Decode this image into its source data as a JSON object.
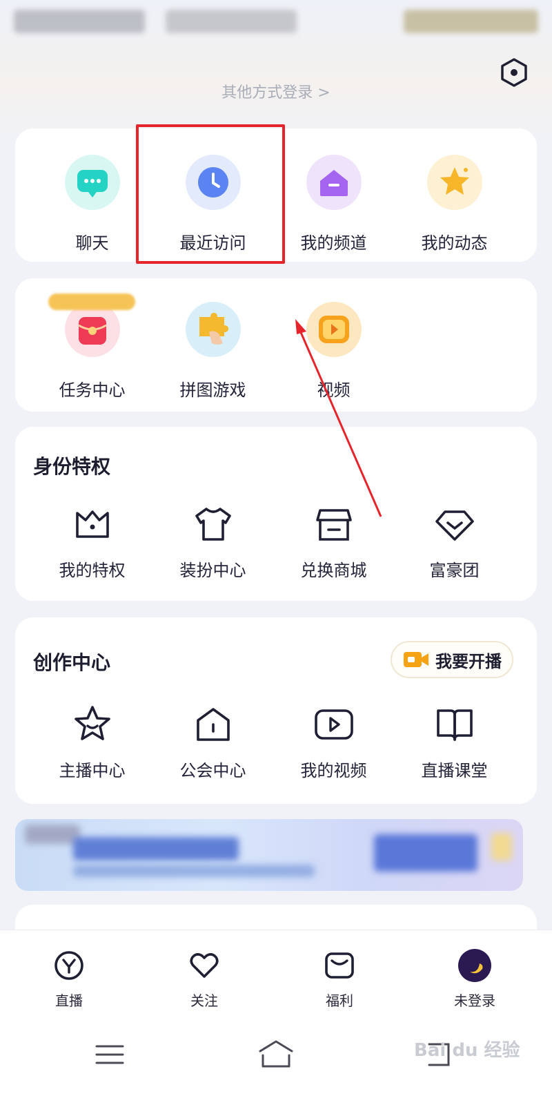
{
  "header": {
    "login_other": "其他方式登录 >",
    "settings_icon": "hexagon-settings-icon"
  },
  "quick_access": [
    {
      "label": "聊天",
      "icon": "chat-bubble-icon",
      "color": "#22d6c6"
    },
    {
      "label": "最近访问",
      "icon": "clock-icon",
      "color": "#5b84f2"
    },
    {
      "label": "我的频道",
      "icon": "channel-house-icon",
      "color": "#a564f0"
    },
    {
      "label": "我的动态",
      "icon": "star-icon",
      "color": "#f7b52a"
    }
  ],
  "features": [
    {
      "label": "任务中心",
      "icon": "red-envelope-icon",
      "color": "#ee3a55"
    },
    {
      "label": "拼图游戏",
      "icon": "puzzle-icon",
      "color": "#f4b92e"
    },
    {
      "label": "视频",
      "icon": "video-play-icon",
      "color": "#f6a21c"
    }
  ],
  "privileges": {
    "title": "身份特权",
    "items": [
      {
        "label": "我的特权",
        "icon": "crown-icon"
      },
      {
        "label": "装扮中心",
        "icon": "tshirt-icon"
      },
      {
        "label": "兑换商城",
        "icon": "shop-icon"
      },
      {
        "label": "富豪团",
        "icon": "diamond-icon"
      }
    ]
  },
  "creator": {
    "title": "创作中心",
    "live_button": "我要开播",
    "items": [
      {
        "label": "主播中心",
        "icon": "smile-star-icon"
      },
      {
        "label": "公会中心",
        "icon": "house-icon"
      },
      {
        "label": "我的视频",
        "icon": "play-square-icon"
      },
      {
        "label": "直播课堂",
        "icon": "open-book-icon"
      }
    ]
  },
  "tabbar": [
    {
      "label": "直播",
      "icon": "live-y-icon"
    },
    {
      "label": "关注",
      "icon": "heart-icon"
    },
    {
      "label": "福利",
      "icon": "gift-envelope-icon"
    },
    {
      "label": "未登录",
      "icon": "avatar-moon-icon"
    }
  ],
  "navbar": [
    "menu-icon",
    "home-icon",
    "back-icon"
  ],
  "annotation": {
    "highlight_color": "#e6242b"
  },
  "watermark": "Bai du 经验"
}
